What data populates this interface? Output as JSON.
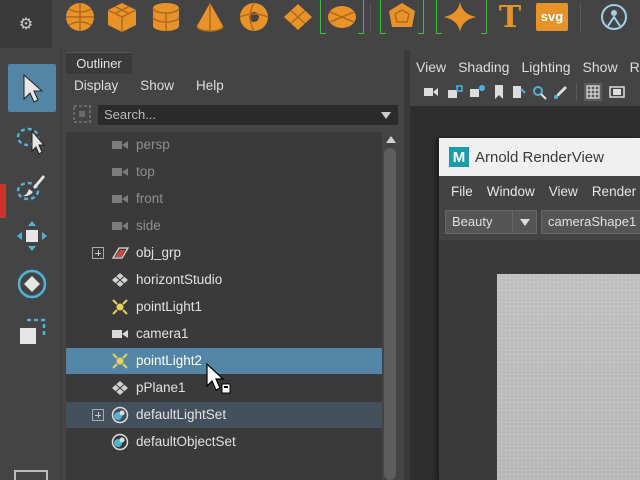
{
  "shelf": {
    "settings_icon": "gear-icon",
    "items": [
      {
        "icon": "poly-sphere-icon"
      },
      {
        "icon": "poly-cube-icon"
      },
      {
        "icon": "poly-cylinder-icon"
      },
      {
        "icon": "poly-cone-icon"
      },
      {
        "icon": "poly-torus-icon"
      },
      {
        "icon": "poly-plane-icon"
      },
      {
        "icon": "poly-disc-icon"
      },
      {
        "icon": "platonic-solid-icon"
      },
      {
        "icon": "super-shape-icon"
      },
      {
        "icon": "text-icon",
        "glyph": "T"
      },
      {
        "icon": "svg-icon",
        "label": "svg"
      },
      {
        "icon": "sweep-mesh-icon"
      }
    ],
    "accent_color": "#e8922a"
  },
  "toolbar": {
    "tools": [
      {
        "name": "select-tool",
        "active": true
      },
      {
        "name": "lasso-tool",
        "active": false
      },
      {
        "name": "paint-select-tool",
        "active": false
      },
      {
        "name": "move-tool",
        "active": false
      },
      {
        "name": "rotate-tool",
        "active": false
      },
      {
        "name": "scale-tool",
        "active": false
      }
    ]
  },
  "outliner": {
    "tab_label": "Outliner",
    "menus": [
      "Display",
      "Show",
      "Help"
    ],
    "search_placeholder": "Search...",
    "rows": [
      {
        "label": "persp",
        "icon": "camera-icon",
        "dim": true,
        "expander": false
      },
      {
        "label": "top",
        "icon": "camera-icon",
        "dim": true,
        "expander": false
      },
      {
        "label": "front",
        "icon": "camera-icon",
        "dim": true,
        "expander": false
      },
      {
        "label": "side",
        "icon": "camera-icon",
        "dim": true,
        "expander": false
      },
      {
        "label": "obj_grp",
        "icon": "group-icon",
        "dim": false,
        "expander": true
      },
      {
        "label": "horizontStudio",
        "icon": "mesh-icon",
        "dim": false,
        "expander": false
      },
      {
        "label": "pointLight1",
        "icon": "point-light-icon",
        "dim": false,
        "expander": false
      },
      {
        "label": "camera1",
        "icon": "camera-icon",
        "dim": false,
        "expander": false
      },
      {
        "label": "pointLight2",
        "icon": "point-light-icon",
        "dim": false,
        "expander": false,
        "selected": true
      },
      {
        "label": "pPlane1",
        "icon": "mesh-icon",
        "dim": false,
        "expander": false
      },
      {
        "label": "defaultLightSet",
        "icon": "set-icon",
        "dim": false,
        "expander": true,
        "highlighted": true
      },
      {
        "label": "defaultObjectSet",
        "icon": "set-icon",
        "dim": false,
        "expander": false
      }
    ],
    "selection_color": "#5285a6"
  },
  "viewport": {
    "menus": [
      "View",
      "Shading",
      "Lighting",
      "Show",
      "Rend"
    ]
  },
  "arnold": {
    "title": "Arnold RenderView",
    "logo_letter": "M",
    "menus": [
      "File",
      "Window",
      "View",
      "Render"
    ],
    "aov_value": "Beauty",
    "camera_value": "cameraShape1"
  }
}
